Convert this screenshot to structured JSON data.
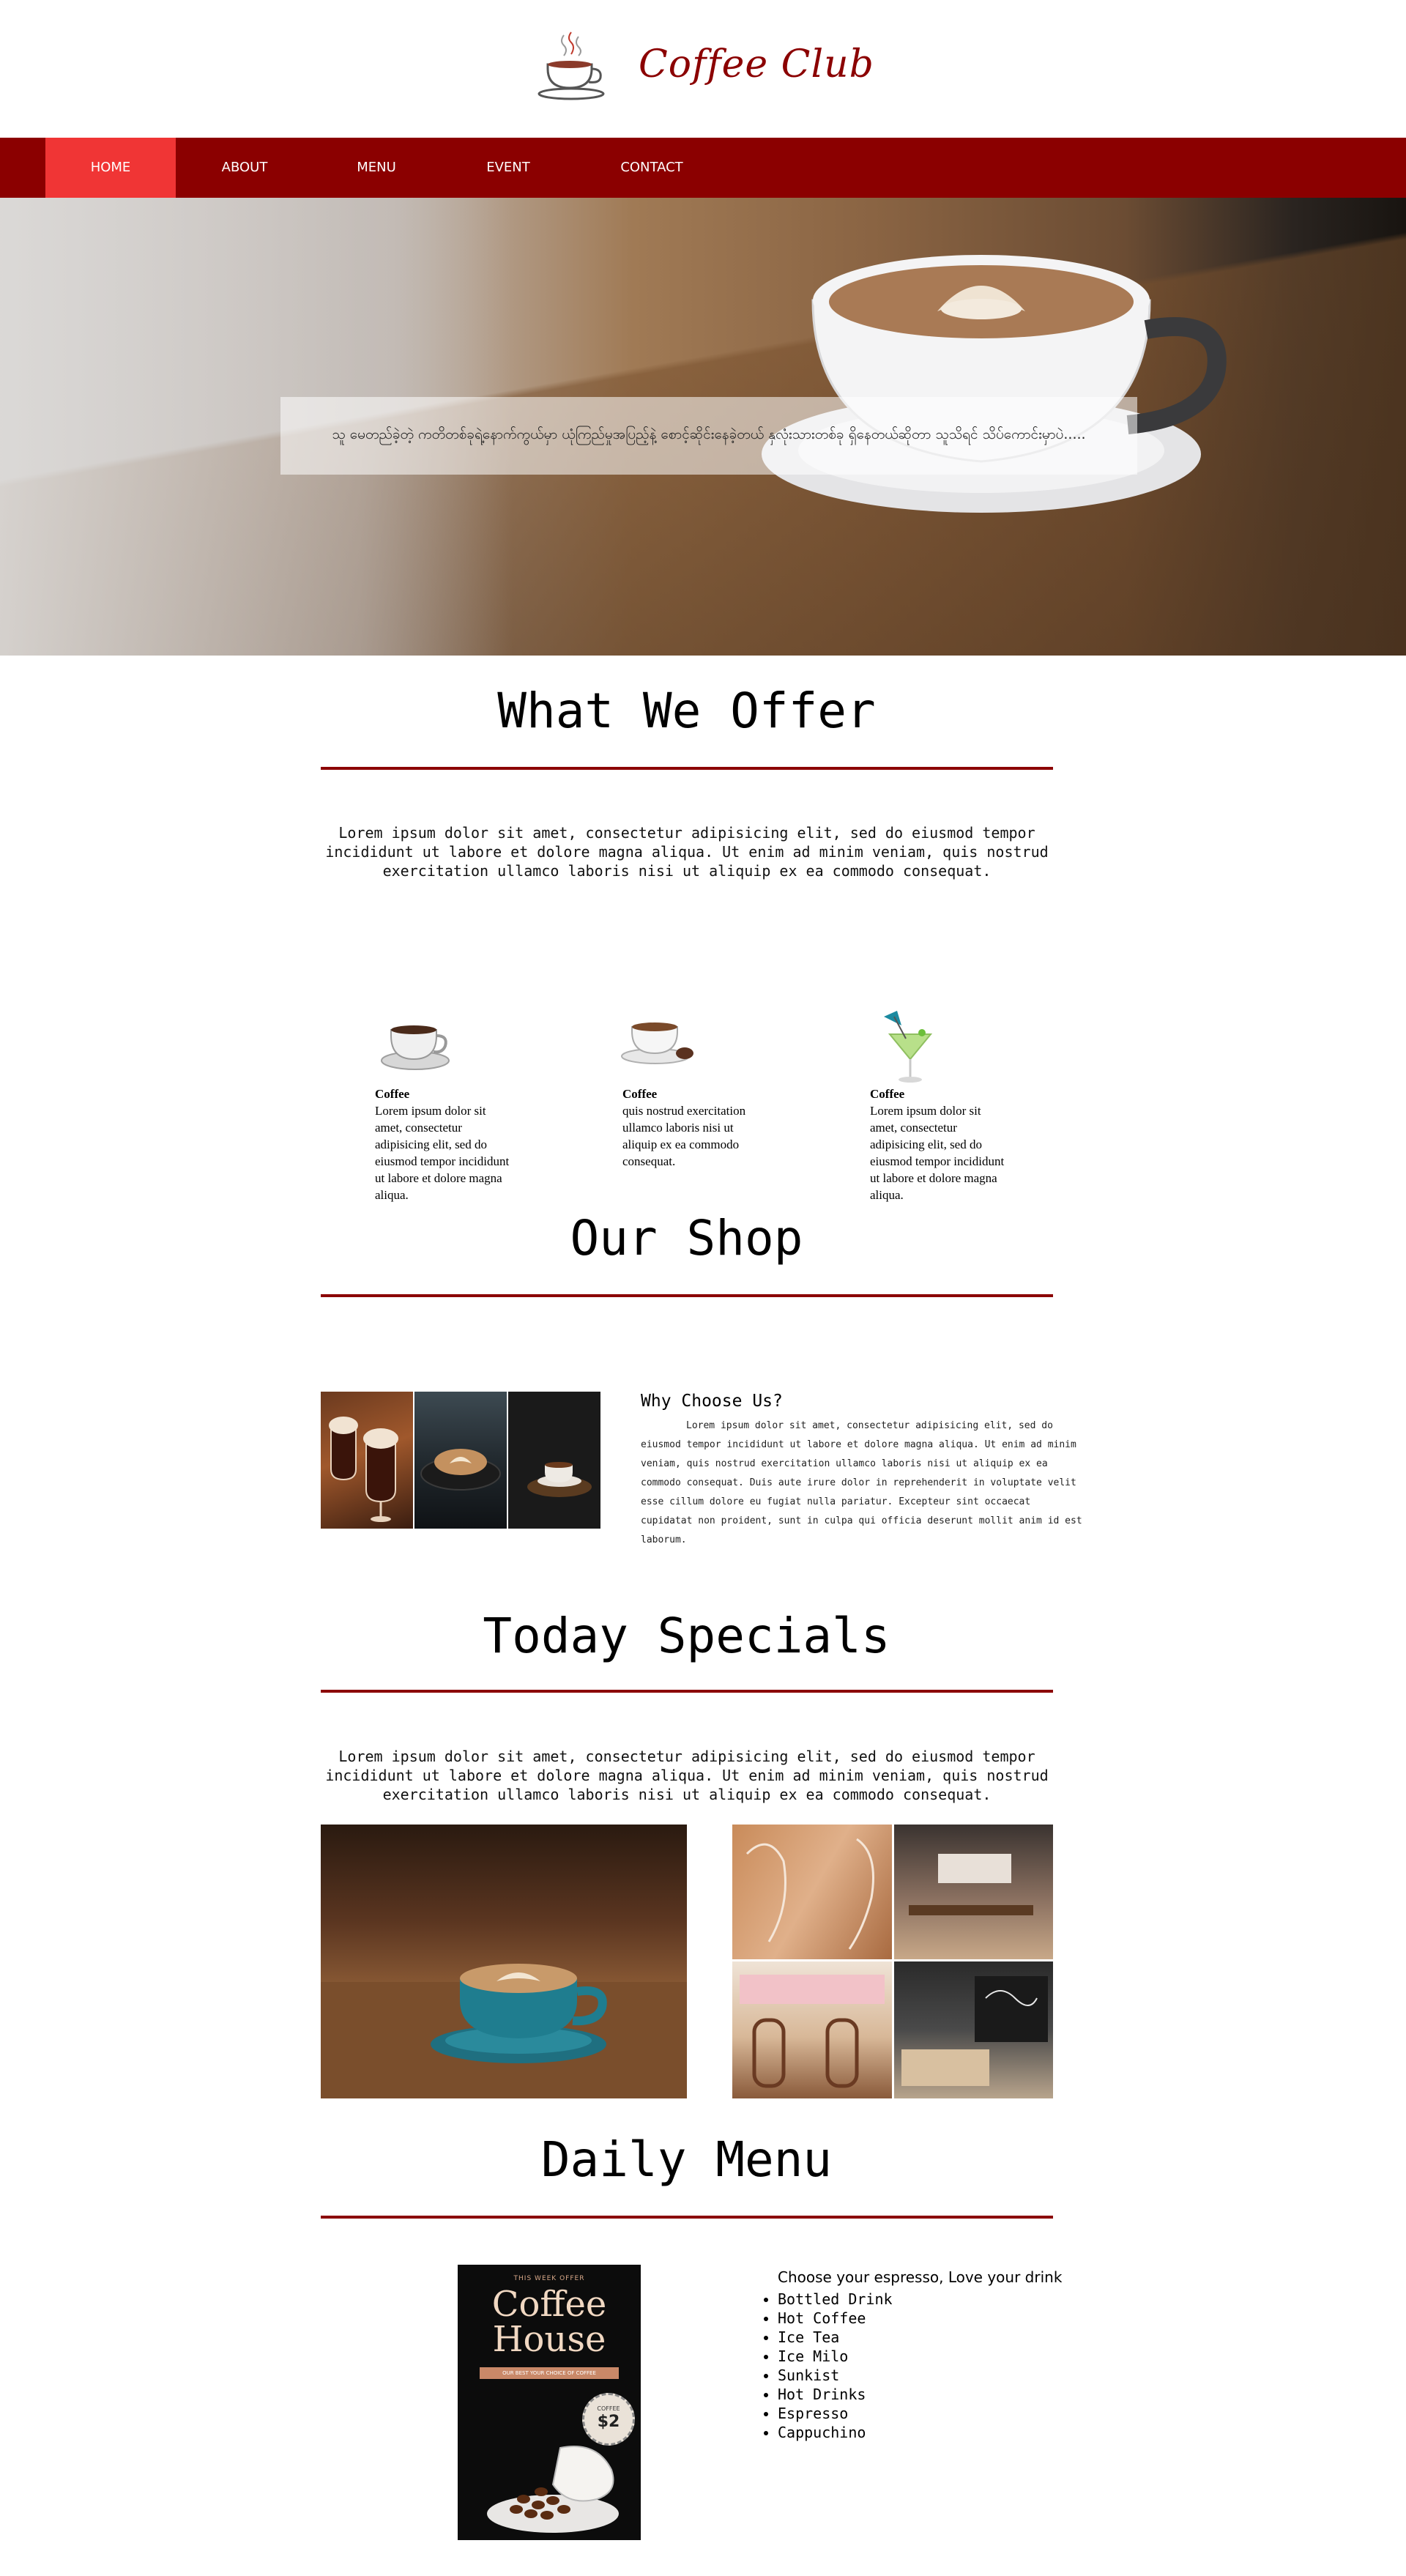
{
  "brand": {
    "name": "Coffee Club",
    "logo_icon": "coffee-cup-icon"
  },
  "colors": {
    "nav": "#8b0000",
    "nav_active": "#f03535",
    "accent": "#8b0000"
  },
  "nav": {
    "items": [
      {
        "label": "HOME",
        "active": true
      },
      {
        "label": "ABOUT"
      },
      {
        "label": "MENU"
      },
      {
        "label": "EVENT"
      },
      {
        "label": "CONTACT"
      }
    ]
  },
  "hero": {
    "caption": "သူ မေတည်ခဲ့တဲ့ ကတိတစ်ခုရဲ့နောက်ကွယ်မှာ ယုံကြည်မှုအပြည့်နဲ့ စောင့်ဆိုင်းနေခဲ့တယ် နှလုံးသားတစ်ခု ရှိနေတယ်ဆိုတာ သူသိရင် သိပ်ကောင်းမှာပဲ.....",
    "image": "latte-art-cup-photo"
  },
  "offer": {
    "title": "What We Offer",
    "text": "Lorem ipsum dolor sit amet, consectetur adipisicing elit, sed do eiusmod tempor incididunt ut labore et dolore magna aliqua. Ut enim ad minim veniam, quis nostrud exercitation ullamco laboris nisi ut aliquip ex ea commodo consequat.",
    "items": [
      {
        "title": "Coffee",
        "text": "Lorem ipsum dolor sit amet, consectetur adipisicing elit, sed do eiusmod tempor incididunt ut labore et dolore magna aliqua.",
        "icon": "coffee-cup-icon"
      },
      {
        "title": "Coffee",
        "text": "quis nostrud exercitation ullamco laboris nisi ut aliquip ex ea commodo consequat.",
        "icon": "coffee-cup-with-chocolate-icon"
      },
      {
        "title": "Coffee",
        "text": "Lorem ipsum dolor sit amet, consectetur adipisicing elit, sed do eiusmod tempor incididunt ut labore et dolore magna aliqua.",
        "icon": "cocktail-glass-icon"
      }
    ]
  },
  "shop": {
    "title": "Our Shop",
    "why_title": "Why Choose Us?",
    "why_text": "Lorem ipsum dolor sit amet, consectetur adipisicing elit, sed do eiusmod tempor incididunt ut labore et dolore magna aliqua. Ut enim ad minim veniam, quis nostrud exercitation ullamco laboris nisi ut aliquip ex ea commodo consequat. Duis aute irure dolor in reprehenderit in voluptate velit esse cillum dolore eu fugiat nulla pariatur. Excepteur sint occaecat cupidatat non proident, sunt in culpa qui officia deserunt mollit anim id est laborum."
  },
  "specials": {
    "title": "Today Specials",
    "text": "Lorem ipsum dolor sit amet, consectetur adipisicing elit, sed do eiusmod tempor incididunt ut labore et dolore magna aliqua. Ut enim ad minim veniam, quis nostrud exercitation ullamco laboris nisi ut aliquip ex ea commodo consequat."
  },
  "menu": {
    "title": "Daily Menu",
    "poster": {
      "kicker": "THIS WEEK OFFER",
      "title_line1": "Coffee",
      "title_line2": "House",
      "band": "OUR BEST YOUR CHOICE OF COFFEE",
      "badge_top": "COFFEE",
      "badge_price": "$2"
    },
    "heading": "Choose your espresso, Love your drink",
    "items": [
      "Bottled Drink",
      "Hot Coffee",
      "Ice Tea",
      "Ice Milo",
      "Sunkist",
      "Hot Drinks",
      "Espresso",
      "Cappuchino"
    ]
  }
}
